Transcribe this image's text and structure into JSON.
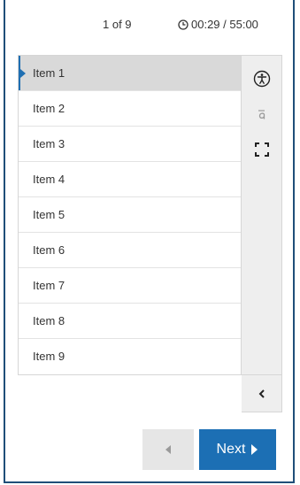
{
  "header": {
    "counter": "1 of 9",
    "timer": "00:29 / 55:00"
  },
  "items": [
    {
      "label": "Item 1",
      "active": true
    },
    {
      "label": "Item 2"
    },
    {
      "label": "Item 3"
    },
    {
      "label": "Item 4"
    },
    {
      "label": "Item 5"
    },
    {
      "label": "Item 6"
    },
    {
      "label": "Item 7"
    },
    {
      "label": "Item 8"
    },
    {
      "label": "Item 9"
    }
  ],
  "toolbar": {
    "icons": [
      "accessibility-icon",
      "translate-icon",
      "fullscreen-icon",
      "collapse-chevron-icon"
    ]
  },
  "footer": {
    "next_label": "Next"
  },
  "colors": {
    "primary": "#1c6fb4",
    "active_row": "#d9d9d9",
    "toolbar_bg": "#eeeeee",
    "frame_border": "#1f4e79"
  }
}
